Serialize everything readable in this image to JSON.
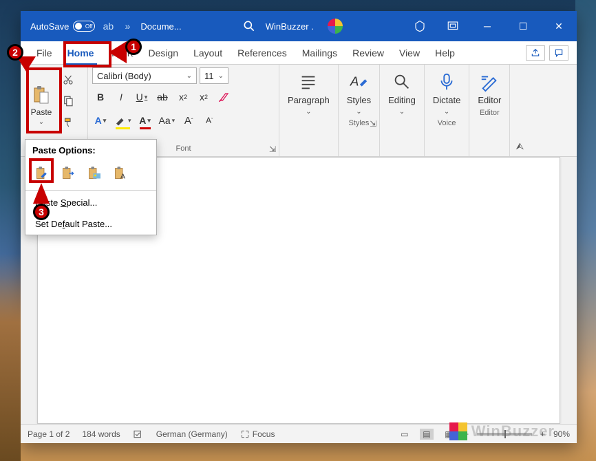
{
  "titlebar": {
    "autosave_label": "AutoSave",
    "autosave_state": "Off",
    "doc_name": "Docume...",
    "user_label": "WinBuzzer ."
  },
  "tabs": {
    "file": "File",
    "home": "Home",
    "insert": "Insert",
    "design": "Design",
    "layout": "Layout",
    "references": "References",
    "mailings": "Mailings",
    "review": "Review",
    "view": "View",
    "help": "Help"
  },
  "ribbon": {
    "clipboard": {
      "paste": "Paste"
    },
    "font": {
      "name": "Calibri (Body)",
      "size": "11",
      "label": "Font",
      "casebtn": "Aa"
    },
    "paragraph": {
      "label": "Paragraph"
    },
    "styles": {
      "label": "Styles",
      "group": "Styles"
    },
    "editing": {
      "label": "Editing"
    },
    "voice": {
      "label": "Dictate",
      "group": "Voice"
    },
    "editor": {
      "label": "Editor",
      "group": "Editor"
    }
  },
  "paste_menu": {
    "title": "Paste Options:",
    "special": "Paste Special...",
    "special_accel": "S",
    "default": "Set Default Paste...",
    "default_accel": "f"
  },
  "statusbar": {
    "page": "Page 1 of 2",
    "words": "184 words",
    "lang": "German (Germany)",
    "focus": "Focus",
    "zoom": "90%"
  },
  "watermark": "WinBuzzer",
  "colors": {
    "accent": "#185abd",
    "red": "#c80000"
  }
}
